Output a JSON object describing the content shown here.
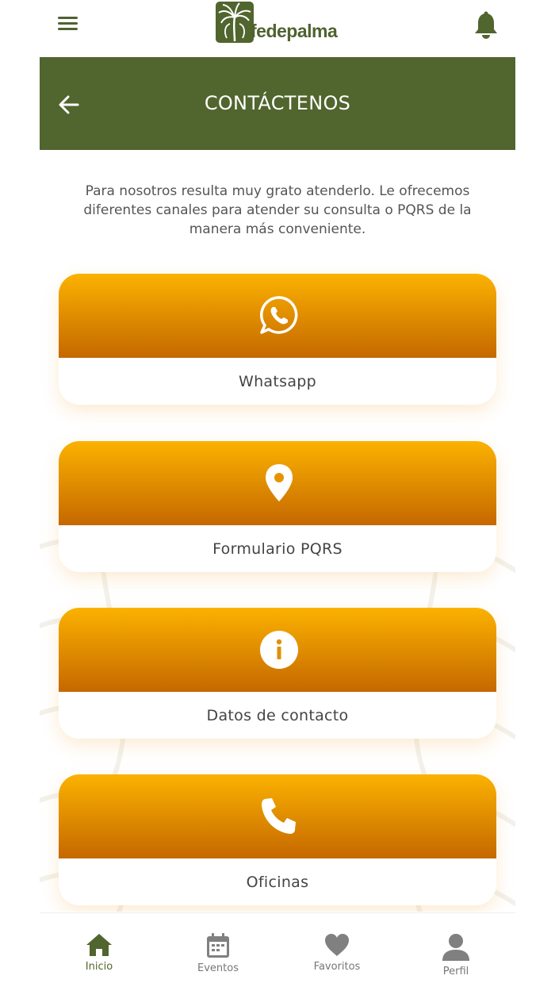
{
  "app": {
    "logo_text": "fedepalma"
  },
  "colors": {
    "brand_green": "#51652e",
    "card_gradient_top": "#fbb200",
    "card_gradient_bottom": "#c56800"
  },
  "header": {
    "title": "CONTÁCTENOS"
  },
  "intro": {
    "text": "Para nosotros resulta muy grato atenderlo. Le ofrecemos diferentes canales para atender su consulta o PQRS de la manera más conveniente."
  },
  "cards": [
    {
      "label": "Whatsapp",
      "icon": "whatsapp-icon"
    },
    {
      "label": "Formulario PQRS",
      "icon": "location-pin-icon"
    },
    {
      "label": "Datos de contacto",
      "icon": "info-icon"
    },
    {
      "label": "Oficinas",
      "icon": "phone-icon"
    }
  ],
  "bottom_nav": [
    {
      "label": "Inicio",
      "icon": "home-icon",
      "active": true
    },
    {
      "label": "Eventos",
      "icon": "calendar-icon",
      "active": false
    },
    {
      "label": "Favoritos",
      "icon": "heart-icon",
      "active": false
    },
    {
      "label": "Perfil",
      "icon": "user-icon",
      "active": false
    }
  ]
}
